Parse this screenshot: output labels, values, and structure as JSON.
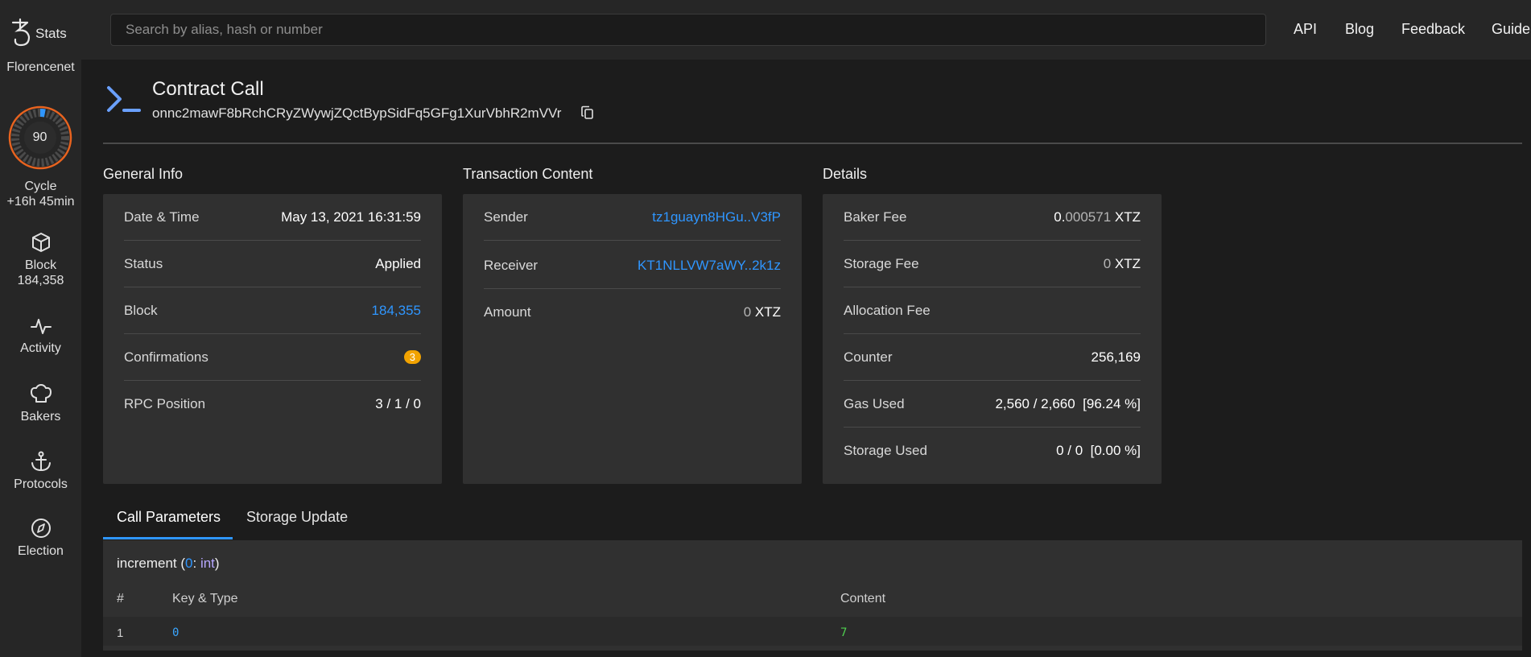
{
  "app": {
    "logo_text": "Stats",
    "network": "Florencenet"
  },
  "sidebar": {
    "cycle_number": "90",
    "cycle_progress": 0.03,
    "cycle_label": "Cycle",
    "cycle_remaining": "+16h 45min",
    "block_label": "Block",
    "block_number": "184,358",
    "items": [
      {
        "label": "Activity",
        "icon": "activity-icon"
      },
      {
        "label": "Bakers",
        "icon": "chef-hat-icon"
      },
      {
        "label": "Protocols",
        "icon": "anchor-icon"
      },
      {
        "label": "Election",
        "icon": "compass-icon"
      }
    ]
  },
  "topbar": {
    "search_placeholder": "Search by alias, hash or number",
    "links": [
      "API",
      "Blog",
      "Feedback",
      "Guide"
    ]
  },
  "header": {
    "title": "Contract Call",
    "hash": "onnc2mawF8bRchCRyZWywjZQctBypSidFq5GFg1XurVbhR2mVVr"
  },
  "general_info": {
    "title": "General Info",
    "date_label": "Date & Time",
    "date_value": "May 13, 2021 16:31:59",
    "status_label": "Status",
    "status_value": "Applied",
    "block_label": "Block",
    "block_value": "184,355",
    "confirmations_label": "Confirmations",
    "confirmations_value": "3",
    "rpc_label": "RPC Position",
    "rpc_value": "3 / 1 / 0"
  },
  "transaction": {
    "title": "Transaction Content",
    "sender_label": "Sender",
    "sender_value": "tz1guayn8HGu..V3fP",
    "receiver_label": "Receiver",
    "receiver_value": "KT1NLLVW7aWY..2k1z",
    "amount_label": "Amount",
    "amount_value": "0",
    "amount_unit": "XTZ"
  },
  "details": {
    "title": "Details",
    "baker_fee_label": "Baker Fee",
    "baker_fee_int": "0.",
    "baker_fee_frac": "000571",
    "baker_fee_unit": "XTZ",
    "storage_fee_label": "Storage Fee",
    "storage_fee_value": "0",
    "storage_fee_unit": "XTZ",
    "allocation_fee_label": "Allocation Fee",
    "counter_label": "Counter",
    "counter_value": "256,169",
    "gas_label": "Gas Used",
    "gas_value": "2,560 / 2,660",
    "gas_pct": "[96.24 %]",
    "storage_used_label": "Storage Used",
    "storage_used_value": "0 / 0",
    "storage_used_pct": "[0.00 %]"
  },
  "tabs": {
    "call_params": "Call Parameters",
    "storage_update": "Storage Update"
  },
  "params": {
    "entrypoint": "increment",
    "arg_index": "0",
    "arg_type": "int",
    "columns": [
      "#",
      "Key & Type",
      "Content"
    ],
    "rows": [
      {
        "index": "1",
        "key": "0",
        "content": "7"
      }
    ]
  },
  "colors": {
    "link": "#2f96ff",
    "badge": "#f2a300",
    "cycle_ring": "#e8631f"
  }
}
